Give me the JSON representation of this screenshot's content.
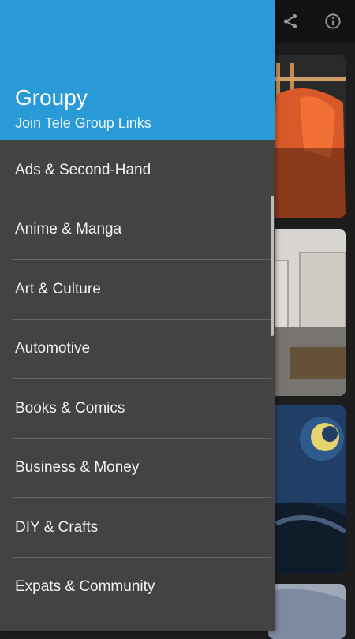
{
  "app": {
    "title": "Groupy",
    "subtitle": "Join Tele Group Links"
  },
  "toolbar": {
    "actions": [
      {
        "icon": "share-icon"
      },
      {
        "icon": "info-icon"
      }
    ]
  },
  "drawer": {
    "items": [
      {
        "label": "Ads & Second-Hand"
      },
      {
        "label": "Anime & Manga"
      },
      {
        "label": "Art & Culture"
      },
      {
        "label": "Automotive"
      },
      {
        "label": "Books & Comics"
      },
      {
        "label": "Business & Money"
      },
      {
        "label": "DIY & Crafts"
      },
      {
        "label": "Expats & Community"
      }
    ]
  },
  "colors": {
    "header": "#2a9ad6",
    "drawer": "#434343",
    "background": "#1d1d1d"
  }
}
